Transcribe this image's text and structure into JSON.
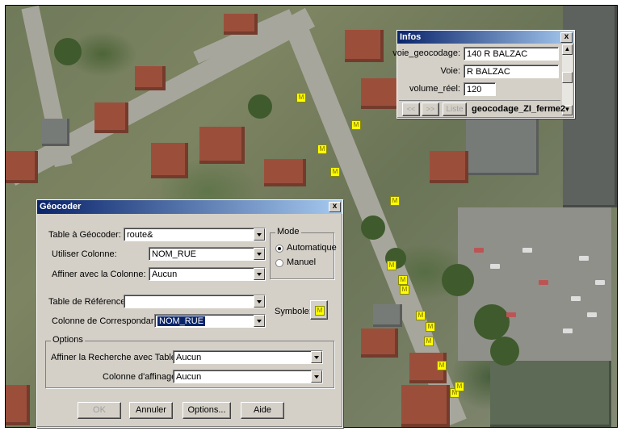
{
  "infos": {
    "title": "Infos",
    "close": "x",
    "rows": [
      {
        "label": "voie_geocodage:",
        "value": "140 R BALZAC"
      },
      {
        "label": "Voie:",
        "value": "R BALZAC"
      },
      {
        "label": "volume_réel:",
        "value": "120"
      }
    ],
    "nav_prev": "<<",
    "nav_next": ">>",
    "liste_label": "Liste",
    "layer_name": "geocodage_ZI_ferme2"
  },
  "geocoder": {
    "title": "Géocoder",
    "close": "x",
    "table_label": "Table à Géocoder:",
    "table_value": "route&",
    "utiliser_label": "Utiliser Colonne:",
    "utiliser_value": "NOM_RUE",
    "affiner_label": "Affiner avec la Colonne:",
    "affiner_value": "Aucun",
    "mode_title": "Mode",
    "mode_auto": "Automatique",
    "mode_manuel": "Manuel",
    "ref_label": "Table de Référence:",
    "ref_value": "",
    "corresp_label": "Colonne de Correspondance:",
    "corresp_value": "NOM_RUE",
    "symbole_label": "Symbole:",
    "options_title": "Options",
    "affiner_table_label": "Affiner la Recherche avec Table:",
    "affiner_table_value": "Aucun",
    "col_affinage_label": "Colonne d'affinage:",
    "col_affinage_value": "Aucun",
    "btn_ok": "OK",
    "btn_annuler": "Annuler",
    "btn_options": "Options...",
    "btn_aide": "Aide"
  },
  "map": {
    "marker_glyph": "M"
  }
}
